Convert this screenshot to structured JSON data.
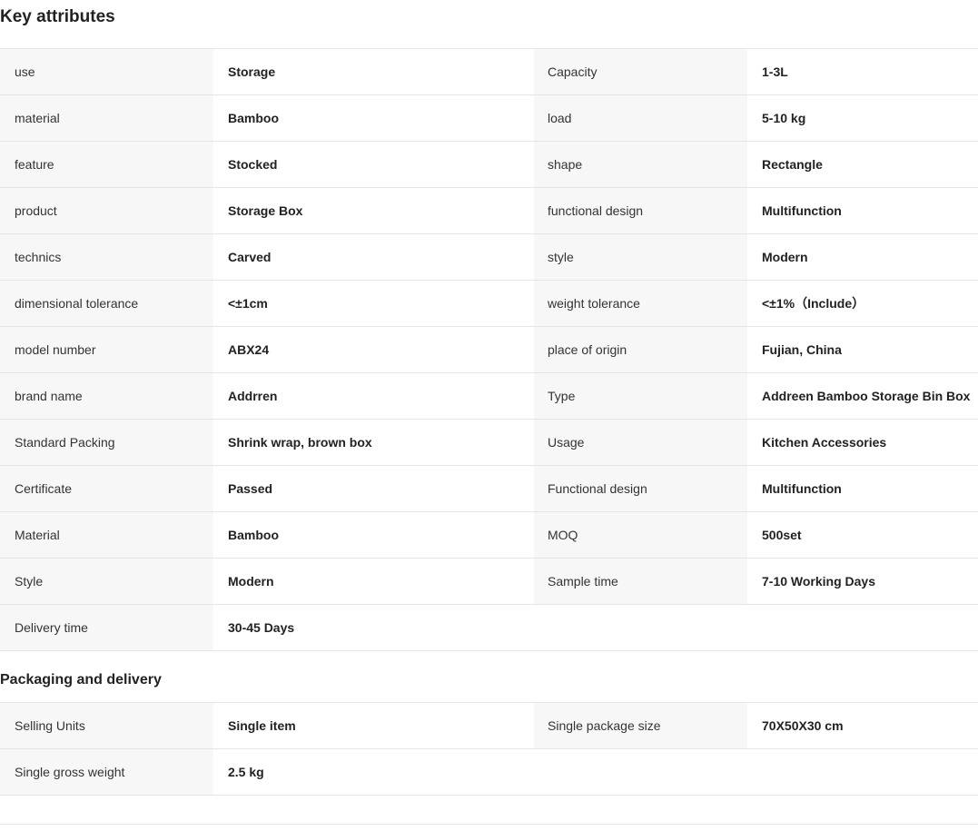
{
  "key_attributes": {
    "title": "Key attributes",
    "rows": [
      {
        "k1": "use",
        "v1": "Storage",
        "k2": "Capacity",
        "v2": "1-3L"
      },
      {
        "k1": "material",
        "v1": "Bamboo",
        "k2": "load",
        "v2": "5-10 kg"
      },
      {
        "k1": "feature",
        "v1": "Stocked",
        "k2": "shape",
        "v2": "Rectangle"
      },
      {
        "k1": "product",
        "v1": "Storage Box",
        "k2": "functional design",
        "v2": "Multifunction"
      },
      {
        "k1": "technics",
        "v1": "Carved",
        "k2": "style",
        "v2": "Modern"
      },
      {
        "k1": "dimensional tolerance",
        "v1": "<±1cm",
        "k2": "weight tolerance",
        "v2": "<±1%（Include）"
      },
      {
        "k1": "model number",
        "v1": "ABX24",
        "k2": "place of origin",
        "v2": "Fujian, China"
      },
      {
        "k1": "brand name",
        "v1": "Addrren",
        "k2": "Type",
        "v2": "Addreen Bamboo Storage Bin Box"
      },
      {
        "k1": "Standard Packing",
        "v1": "Shrink wrap, brown box",
        "k2": "Usage",
        "v2": "Kitchen Accessories"
      },
      {
        "k1": "Certificate",
        "v1": "Passed",
        "k2": "Functional design",
        "v2": "Multifunction"
      },
      {
        "k1": "Material",
        "v1": "Bamboo",
        "k2": "MOQ",
        "v2": "500set"
      },
      {
        "k1": "Style",
        "v1": "Modern",
        "k2": "Sample time",
        "v2": "7-10 Working Days"
      },
      {
        "k1": "Delivery time",
        "v1": "30-45 Days"
      }
    ]
  },
  "packaging": {
    "title": "Packaging and delivery",
    "rows": [
      {
        "k1": "Selling Units",
        "v1": "Single item",
        "k2": "Single package size",
        "v2": "70X50X30 cm"
      },
      {
        "k1": "Single gross weight",
        "v1": "2.5 kg"
      }
    ]
  },
  "colors": {
    "key_cell_bg": "#f7f7f7",
    "border": "#e5e5e5",
    "text": "#222222"
  }
}
